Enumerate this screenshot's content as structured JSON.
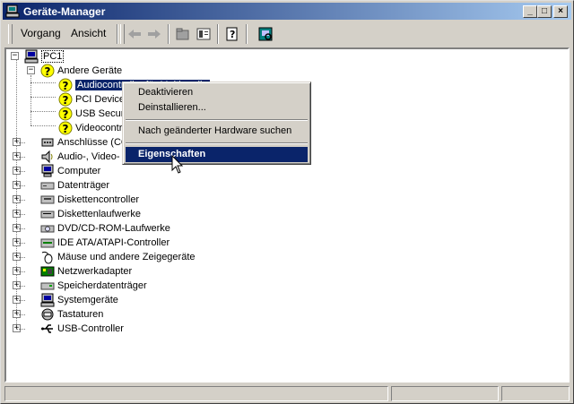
{
  "window": {
    "title": "Geräte-Manager",
    "minimize_glyph": "_",
    "maximize_glyph": "□",
    "close_glyph": "×"
  },
  "menubar": {
    "items": [
      {
        "label": "Vorgang"
      },
      {
        "label": "Ansicht"
      }
    ]
  },
  "toolbar": {
    "icons": [
      "back-arrow-icon",
      "forward-arrow-icon",
      "tree-view-icon",
      "properties-view-icon",
      "help-icon",
      "scan-hardware-icon"
    ]
  },
  "tree": {
    "root": "PC1",
    "other_devices": {
      "label": "Andere Geräte",
      "children": [
        "Audiocontroller für Multimedia",
        "PCI Device",
        "USB Security",
        "Videocontroller"
      ]
    },
    "categories": [
      {
        "label": "Anschlüsse (COM und LPT)",
        "icon": "port-icon"
      },
      {
        "label": "Audio-, Video- und Gamecontroller",
        "icon": "speaker-icon"
      },
      {
        "label": "Computer",
        "icon": "computer-icon"
      },
      {
        "label": "Datenträger",
        "icon": "disk-drive-icon"
      },
      {
        "label": "Diskettencontroller",
        "icon": "floppy-controller-icon"
      },
      {
        "label": "Diskettenlaufwerke",
        "icon": "floppy-drive-icon"
      },
      {
        "label": "DVD/CD-ROM-Laufwerke",
        "icon": "cdrom-icon"
      },
      {
        "label": "IDE ATA/ATAPI-Controller",
        "icon": "ide-controller-icon"
      },
      {
        "label": "Mäuse und andere Zeigegeräte",
        "icon": "mouse-icon"
      },
      {
        "label": "Netzwerkadapter",
        "icon": "network-adapter-icon"
      },
      {
        "label": "Speicherdatenträger",
        "icon": "storage-volume-icon"
      },
      {
        "label": "Systemgeräte",
        "icon": "system-device-icon"
      },
      {
        "label": "Tastaturen",
        "icon": "keyboard-icon"
      },
      {
        "label": "USB-Controller",
        "icon": "usb-icon"
      }
    ]
  },
  "context_menu": {
    "items": [
      {
        "label": "Deaktivieren"
      },
      {
        "label": "Deinstallieren..."
      },
      {
        "label": "Nach geänderter Hardware suchen"
      },
      {
        "label": "Eigenschaften"
      }
    ],
    "highlighted": "Eigenschaften"
  },
  "colors": {
    "titlebar_start": "#0a246a",
    "titlebar_end": "#a6caf0",
    "selection": "#0a246a",
    "face": "#d4d0c8",
    "warning": "#ffff00"
  }
}
